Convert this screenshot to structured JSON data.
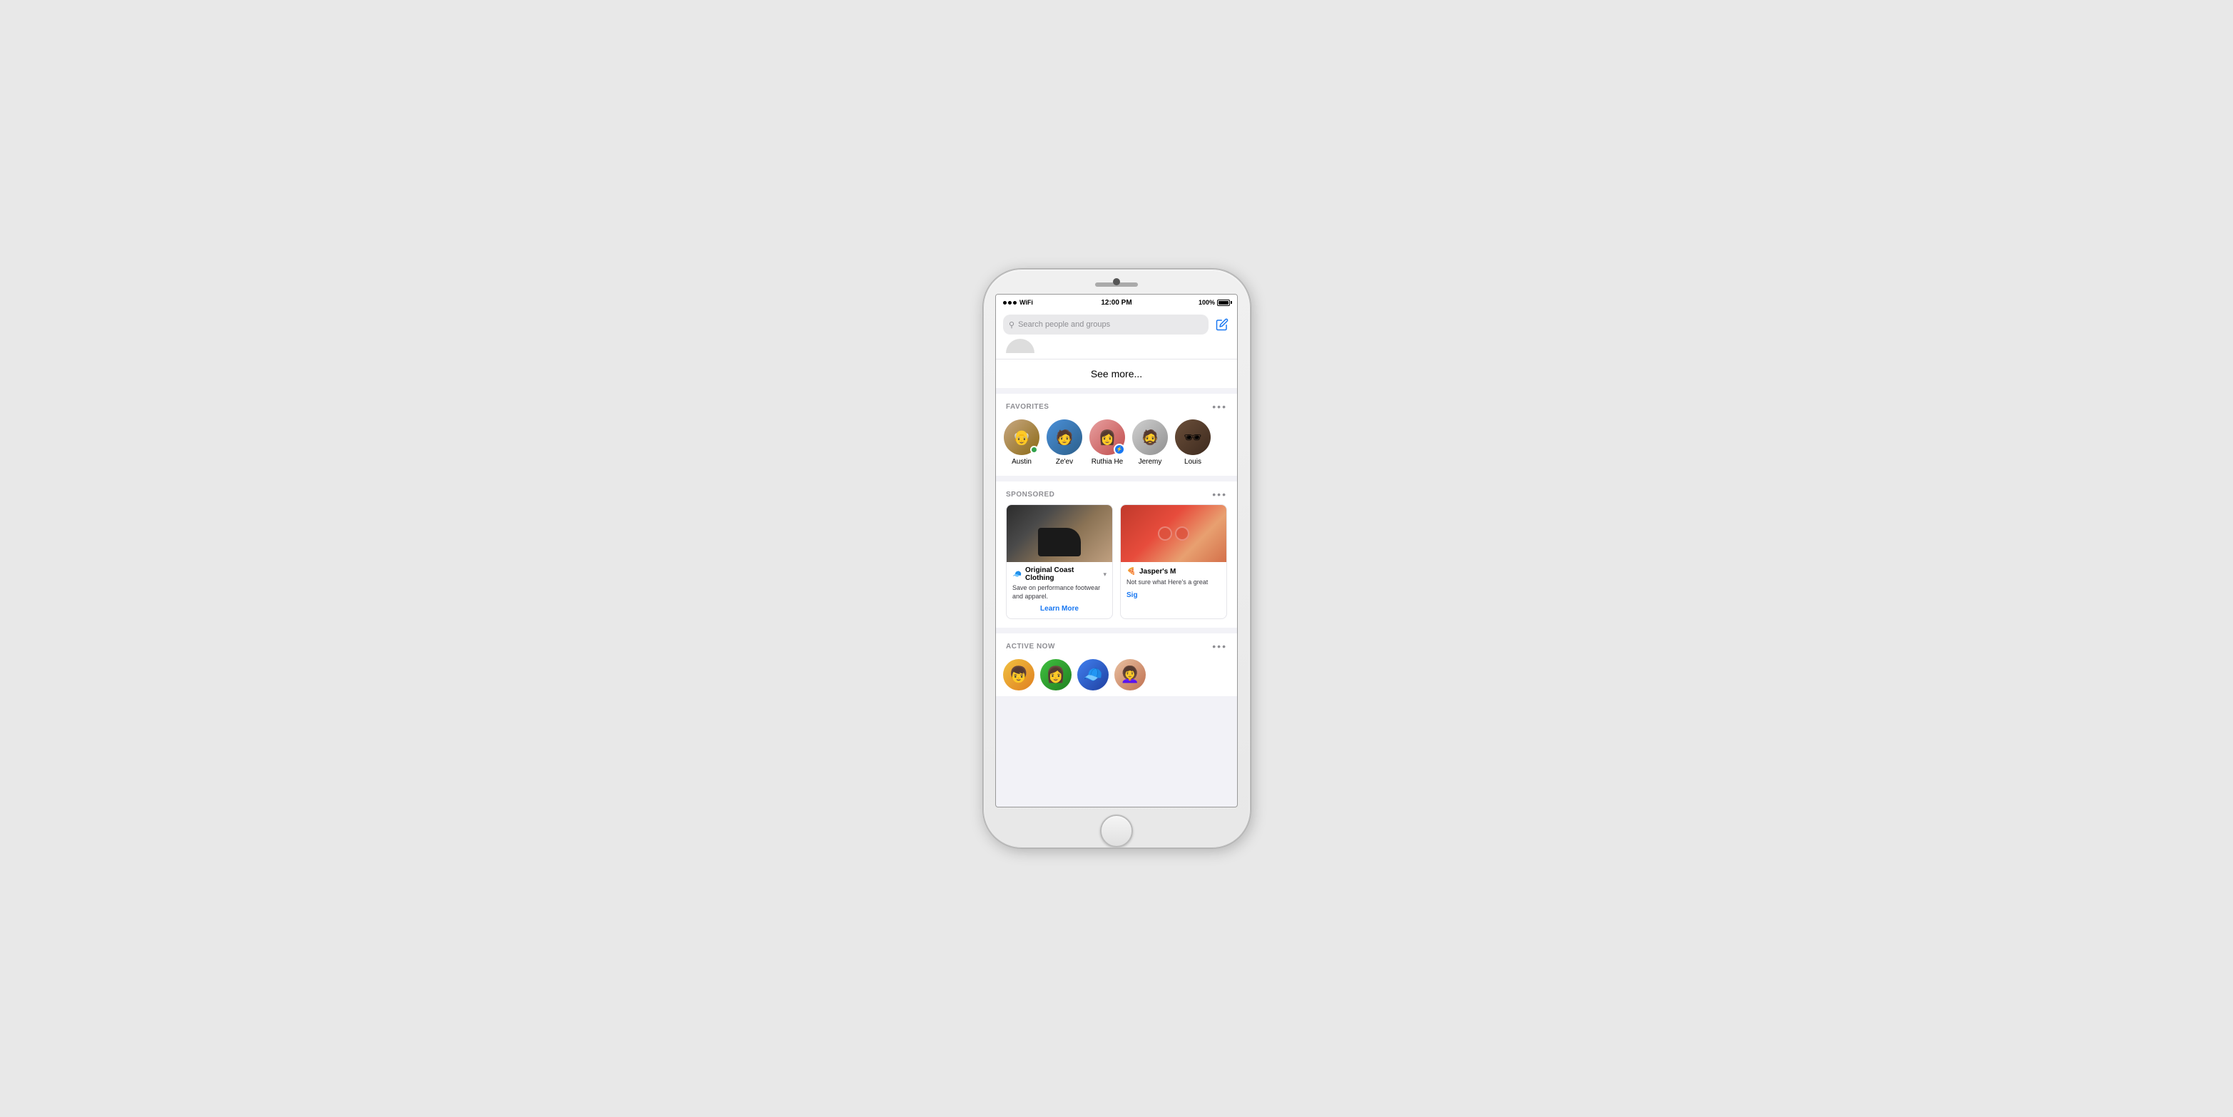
{
  "status_bar": {
    "time": "12:00 PM",
    "battery": "100%",
    "battery_label": "100%"
  },
  "search": {
    "placeholder": "Search people and groups"
  },
  "see_more": {
    "label": "See more..."
  },
  "favorites": {
    "section_title": "FAVORITES",
    "more_label": "•••",
    "people": [
      {
        "name": "Austin",
        "online": true,
        "messenger": false
      },
      {
        "name": "Ze'ev",
        "online": false,
        "messenger": false
      },
      {
        "name": "Ruthia He",
        "online": false,
        "messenger": true
      },
      {
        "name": "Jeremy",
        "online": false,
        "messenger": false
      },
      {
        "name": "Louis",
        "online": false,
        "messenger": false
      }
    ]
  },
  "sponsored": {
    "section_title": "SPONSORED",
    "more_label": "•••",
    "ads": [
      {
        "brand": "Original Coast Clothing",
        "brand_icon": "🧢",
        "description": "Save on performance footwear and apparel.",
        "cta": "Learn More"
      },
      {
        "brand": "Jasper's M",
        "brand_icon": "🍕",
        "description": "Not sure what Here's a great",
        "cta": "Sig"
      }
    ]
  },
  "active_now": {
    "section_title": "ACTIVE NOW",
    "more_label": "•••"
  },
  "compose_icon": "✏",
  "search_icon": "🔍"
}
